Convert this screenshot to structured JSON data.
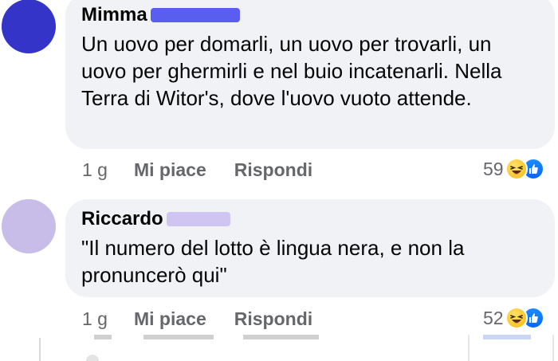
{
  "colors": {
    "bubble": "#f0f2f5",
    "secondary_text": "#65676b",
    "primary_text": "#050505",
    "avatar_1": "#3434c8",
    "avatar_2": "#c8bde8",
    "redaction_1": "#5a5ef0",
    "redaction_2": "#cfc4f2",
    "like_blue": "#0866ff",
    "haha_yellow": "#f7c631"
  },
  "comments": [
    {
      "author": "Mimma",
      "text": "Un uovo per domarli, un uovo per trovarli, un uovo per ghermirli e nel buio incatenarli. Nella Terra di Witor's, dove l'uovo  vuoto attende.",
      "time": "1 g",
      "like_label": "Mi piace",
      "reply_label": "Rispondi",
      "reaction_count": "59",
      "reaction_icons": [
        "haha-icon",
        "like-icon"
      ]
    },
    {
      "author": "Riccardo",
      "text": "\"Il numero del lotto è lingua nera, e non la pronuncerò qui\"",
      "time": "1 g",
      "like_label": "Mi piace",
      "reply_label": "Rispondi",
      "reaction_count": "52",
      "reaction_icons": [
        "haha-icon",
        "like-icon"
      ]
    }
  ]
}
